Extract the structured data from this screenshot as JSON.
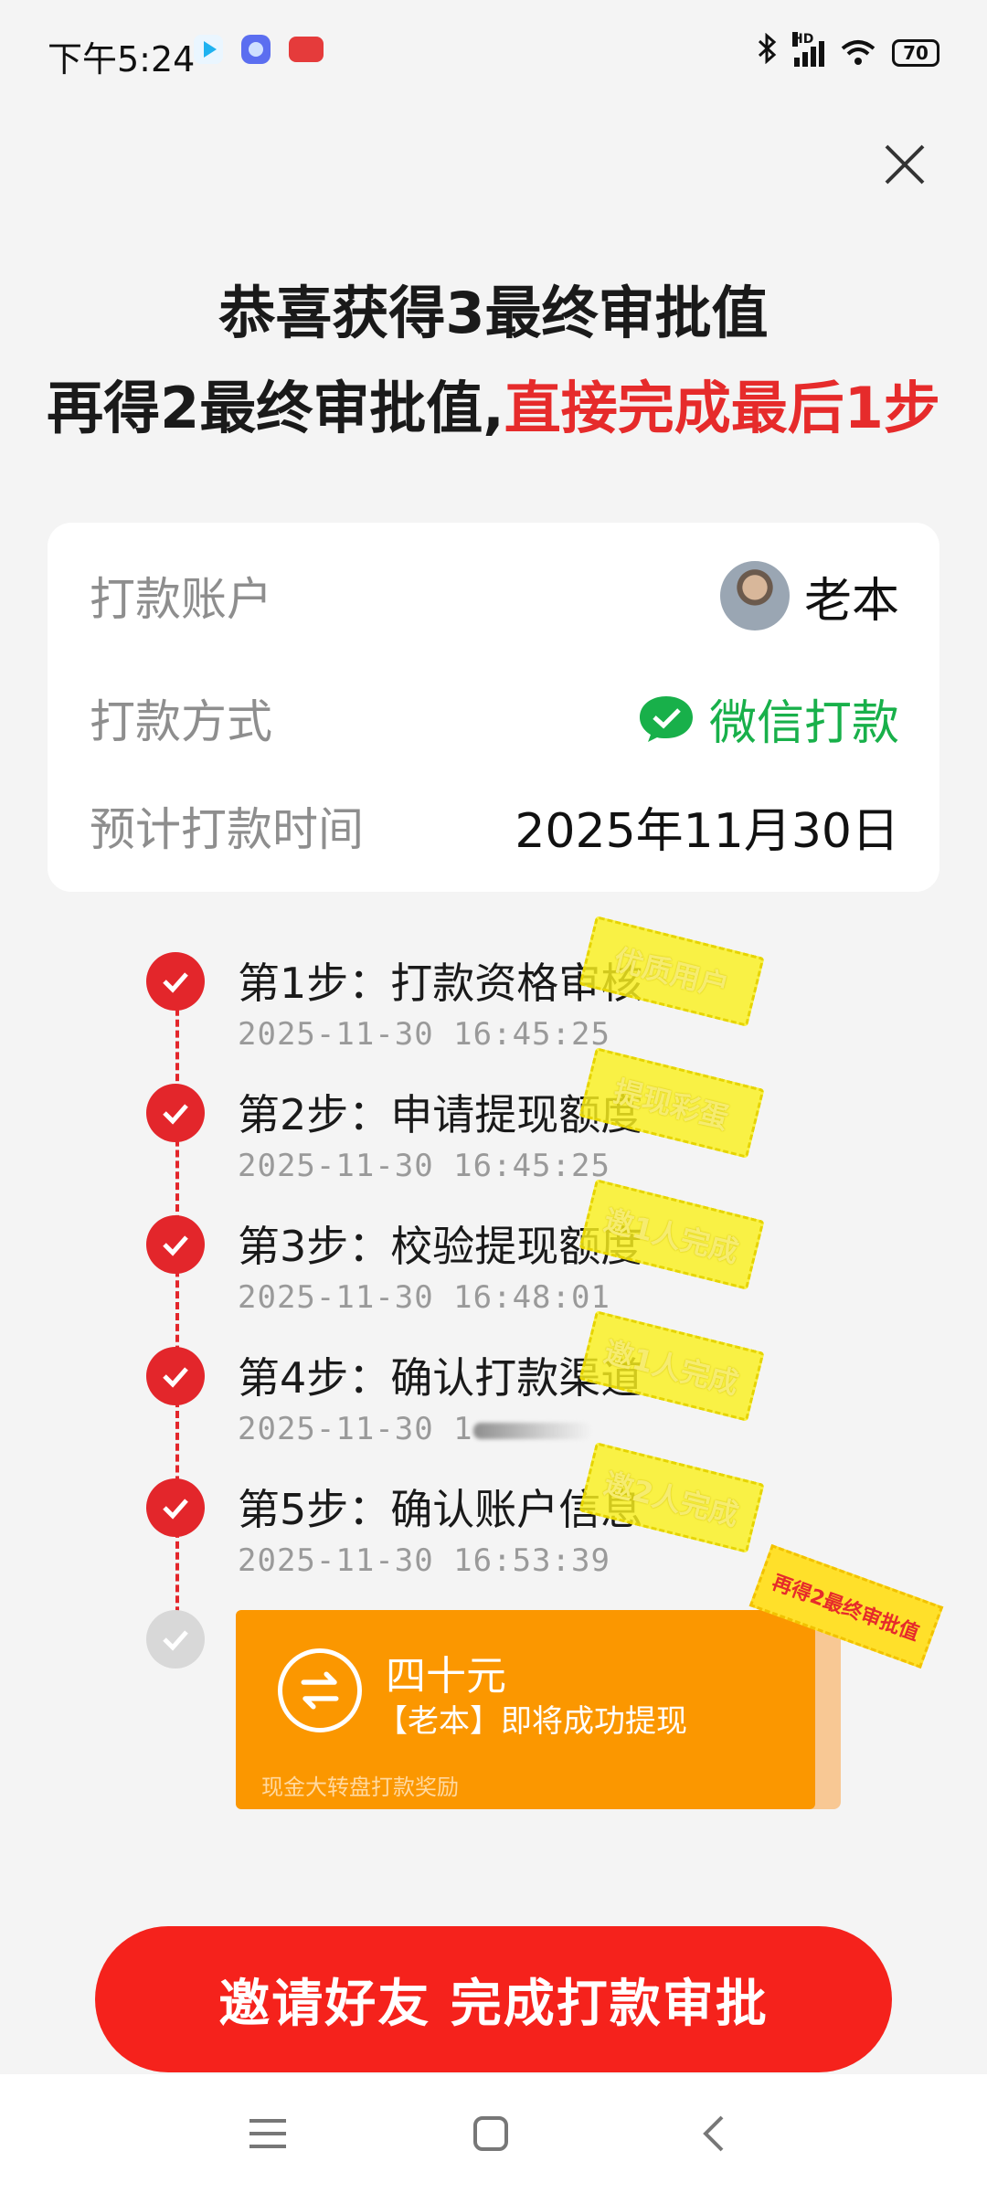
{
  "status_bar": {
    "time": "下午5:24",
    "signal_label": "HD",
    "battery": "70"
  },
  "headline": {
    "line1": "恭喜获得3最终审批值",
    "line2_black": "再得2最终审批值,",
    "line2_red": "直接完成最后1步"
  },
  "info": {
    "account_label": "打款账户",
    "account_value": "老本",
    "method_label": "打款方式",
    "method_value": "微信打款",
    "time_label": "预计打款时间",
    "time_value": "2025年11月30日"
  },
  "steps": [
    {
      "title": "第1步：打款资格审核",
      "time": "2025-11-30 16:45:25",
      "stamp": "优质用户"
    },
    {
      "title": "第2步：申请提现额度",
      "time": "2025-11-30 16:45:25",
      "stamp": "提现彩蛋"
    },
    {
      "title": "第3步：校验提现额度",
      "time": "2025-11-30 16:48:01",
      "stamp": "邀1人完成"
    },
    {
      "title": "第4步：确认打款渠道",
      "time": "2025-11-30 1",
      "stamp": "邀1人完成"
    },
    {
      "title": "第5步：确认账户信息",
      "time": "2025-11-30 16:53:39",
      "stamp": "邀2人完成"
    }
  ],
  "reward": {
    "amount": "四十元",
    "subtitle": "【老本】即将成功提现",
    "footnote": "现金大转盘打款奖励",
    "badge": "再得2最终审批值"
  },
  "cta": {
    "label": "邀请好友 完成打款审批"
  },
  "colors": {
    "accent_red": "#e3262b",
    "wechat_green": "#18b04a",
    "reward_orange": "#fb9700",
    "stamp_yellow": "#f5ec2a"
  }
}
